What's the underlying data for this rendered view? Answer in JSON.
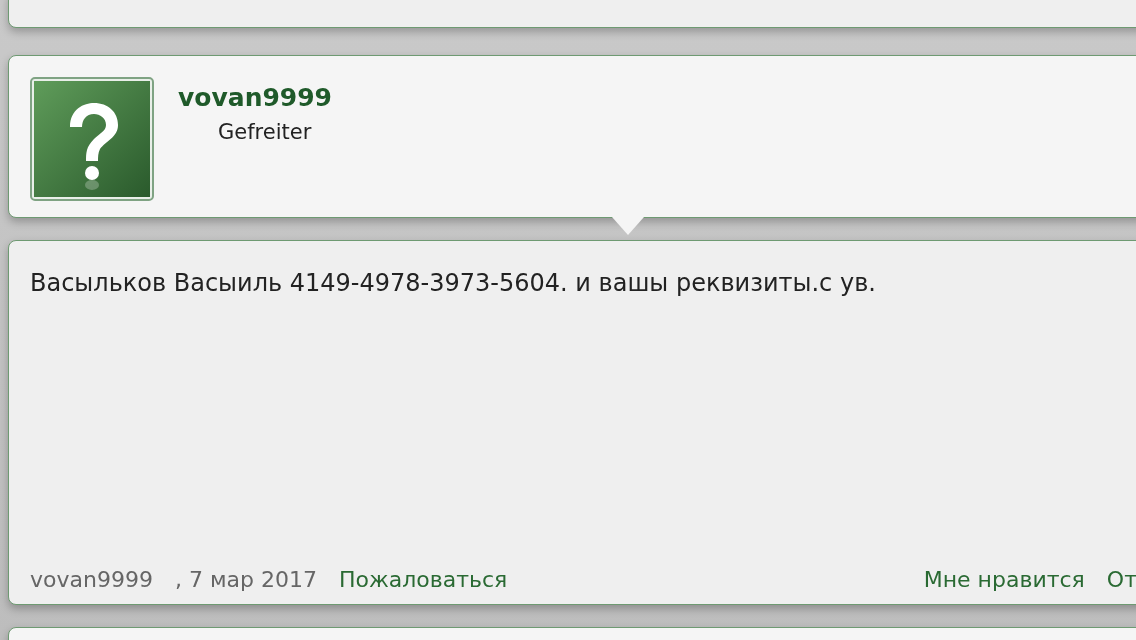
{
  "profile": {
    "username": "vovan9999",
    "rank": "Gefreiter"
  },
  "message": {
    "text": "Васыльков Васыиль 4149-4978-3973-5604. и вашы реквизиты.с ув.",
    "footer": {
      "author": "vovan9999",
      "date": ", 7 мар 2017",
      "report": "Пожаловаться",
      "like": "Мне нравится",
      "reply": "От"
    }
  }
}
